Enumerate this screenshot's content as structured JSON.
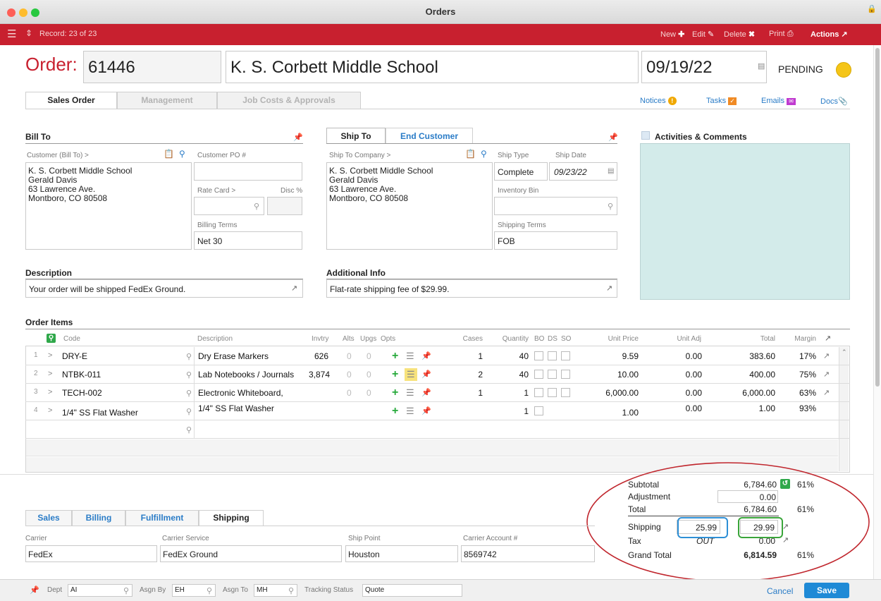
{
  "window": {
    "title": "Orders"
  },
  "toolbar": {
    "record": "Record: 23 of 23",
    "new_label": "New",
    "edit_label": "Edit",
    "delete_label": "Delete",
    "print_label": "Print",
    "actions_label": "Actions"
  },
  "header": {
    "order_label": "Order:",
    "order_number": "61446",
    "customer_name": "K. S. Corbett Middle School",
    "date": "09/19/22",
    "status": "PENDING",
    "status_color": "#f5c518"
  },
  "tabs": [
    {
      "label": "Sales Order"
    },
    {
      "label": "Management"
    },
    {
      "label": "Job Costs & Approvals"
    }
  ],
  "links": {
    "notices": "Notices",
    "tasks": "Tasks",
    "emails": "Emails",
    "docs": "Docs"
  },
  "bill_to": {
    "title": "Bill To",
    "customer_label": "Customer (Bill To) >",
    "address_lines": [
      "K. S. Corbett Middle School",
      "Gerald Davis",
      "63 Lawrence Ave.",
      "Montboro, CO 80508"
    ],
    "po_label": "Customer PO #",
    "po_value": "",
    "rate_card_label": "Rate Card >",
    "disc_label": "Disc %",
    "billing_terms_label": "Billing Terms",
    "billing_terms_value": "Net 30"
  },
  "ship_to": {
    "tab_ship_to": "Ship To",
    "tab_end_customer": "End Customer",
    "company_label": "Ship To Company >",
    "address_lines": [
      "K. S. Corbett Middle School",
      "Gerald Davis",
      "63 Lawrence Ave.",
      "Montboro, CO 80508"
    ],
    "ship_type_label": "Ship Type",
    "ship_type_value": "Complete",
    "ship_date_label": "Ship Date",
    "ship_date_value": "09/23/22",
    "inventory_bin_label": "Inventory Bin",
    "shipping_terms_label": "Shipping Terms",
    "shipping_terms_value": "FOB"
  },
  "activities": {
    "title": "Activities & Comments"
  },
  "description": {
    "label": "Description",
    "value": "Your order will be shipped FedEx Ground."
  },
  "additional_info": {
    "label": "Additional Info",
    "value": "Flat-rate shipping fee of $29.99."
  },
  "order_items": {
    "title": "Order Items",
    "columns": {
      "code": "Code",
      "description": "Description",
      "invtry": "Invtry",
      "alts": "Alts",
      "upgs": "Upgs",
      "opts": "Opts",
      "cases": "Cases",
      "quantity": "Quantity",
      "bo": "BO",
      "ds": "DS",
      "so": "SO",
      "unit_price": "Unit Price",
      "unit_adj": "Unit Adj",
      "total": "Total",
      "margin": "Margin"
    },
    "rows": [
      {
        "num": "1",
        "code": "DRY-E",
        "description": "Dry Erase Markers",
        "invtry": "626",
        "alts": "0",
        "upgs": "0",
        "cases": "1",
        "quantity": "40",
        "unit_price": "9.59",
        "unit_adj": "0.00",
        "total": "383.60",
        "margin": "17%"
      },
      {
        "num": "2",
        "code": "NTBK-011",
        "description": "Lab Notebooks / Journals",
        "invtry": "3,874",
        "alts": "0",
        "upgs": "0",
        "cases": "2",
        "quantity": "40",
        "unit_price": "10.00",
        "unit_adj": "0.00",
        "total": "400.00",
        "margin": "75%"
      },
      {
        "num": "3",
        "code": "TECH-002",
        "description": "Electronic Whiteboard,",
        "invtry": "",
        "alts": "0",
        "upgs": "0",
        "cases": "1",
        "quantity": "1",
        "unit_price": "6,000.00",
        "unit_adj": "0.00",
        "total": "6,000.00",
        "margin": "63%"
      },
      {
        "num": "4",
        "code": "1/4\" SS Flat Washer",
        "description": "1/4\" SS Flat Washer",
        "invtry": "",
        "alts": "",
        "upgs": "",
        "cases": "",
        "quantity": "1",
        "unit_price": "1.00",
        "unit_adj": "0.00",
        "total": "1.00",
        "margin": "93%"
      }
    ]
  },
  "totals": {
    "subtotal_label": "Subtotal",
    "subtotal_value": "6,784.60",
    "subtotal_margin": "61%",
    "adjustment_label": "Adjustment",
    "adjustment_value": "0.00",
    "total_label": "Total",
    "total_value": "6,784.60",
    "total_margin": "61%",
    "shipping_label": "Shipping",
    "shipping_cost": "25.99",
    "shipping_value": "29.99",
    "tax_label": "Tax",
    "tax_code": "OUT",
    "tax_value": "0.00",
    "grand_total_label": "Grand Total",
    "grand_total_value": "6,814.59",
    "grand_total_margin": "61%"
  },
  "bottom_tabs": [
    {
      "label": "Sales"
    },
    {
      "label": "Billing"
    },
    {
      "label": "Fulfillment"
    },
    {
      "label": "Shipping"
    }
  ],
  "shipping": {
    "carrier_label": "Carrier",
    "carrier_value": "FedEx",
    "service_label": "Carrier Service",
    "service_value": "FedEx Ground",
    "ship_point_label": "Ship Point",
    "ship_point_value": "Houston",
    "account_label": "Carrier Account #",
    "account_value": "8569742"
  },
  "footer": {
    "dept_label": "Dept",
    "dept_value": "AI",
    "asgn_by_label": "Asgn By",
    "asgn_by_value": "EH",
    "asgn_to_label": "Asgn To",
    "asgn_to_value": "MH",
    "tracking_label": "Tracking Status",
    "tracking_value": "Quote",
    "cancel_label": "Cancel",
    "save_label": "Save"
  },
  "colors": {
    "brand_red": "#c8202f",
    "link_blue": "#2a7cc7",
    "annotation_red": "#c0262d",
    "annotation_blue": "#2d8fd6",
    "annotation_green": "#3aa53a"
  }
}
